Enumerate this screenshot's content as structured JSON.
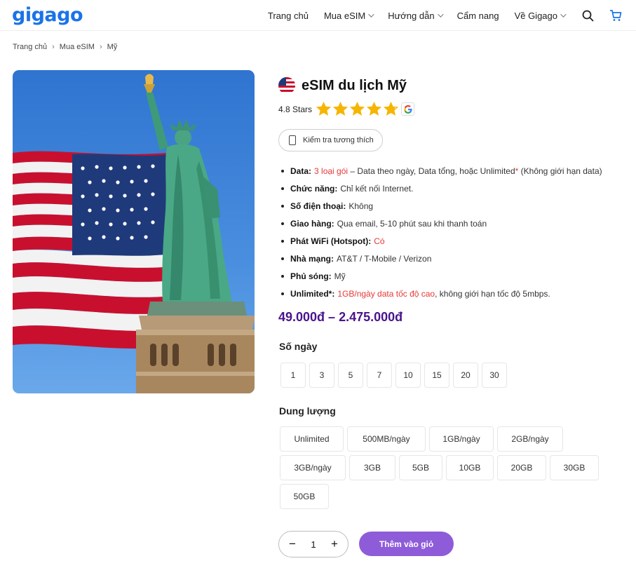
{
  "header": {
    "logo": "gigago",
    "nav": [
      {
        "label": "Trang chủ",
        "dropdown": false
      },
      {
        "label": "Mua eSIM",
        "dropdown": true
      },
      {
        "label": "Hướng dẫn",
        "dropdown": true
      },
      {
        "label": "Cẩm nang",
        "dropdown": false
      },
      {
        "label": "Về Gigago",
        "dropdown": true
      }
    ],
    "icons": [
      "search-icon",
      "cart-icon"
    ]
  },
  "breadcrumb": [
    "Trang chủ",
    "Mua eSIM",
    "Mỹ"
  ],
  "product": {
    "title": "eSIM du lịch Mỹ",
    "rating_text": "4.8 Stars",
    "rating_value": 4.8,
    "check_button": "Kiểm tra tương thích",
    "specs": [
      {
        "label": "Data:",
        "parts": [
          {
            "text": "3 loại gói",
            "red": true
          },
          {
            "text": " – Data theo ngày, Data tổng, hoặc Unlimited",
            "red": false
          },
          {
            "text": "*",
            "red": true
          },
          {
            "text": " (Không giới hạn data)",
            "red": false
          }
        ]
      },
      {
        "label": "Chức năng:",
        "parts": [
          {
            "text": "Chỉ kết nối Internet.",
            "red": false
          }
        ]
      },
      {
        "label": "Số điện thoại:",
        "parts": [
          {
            "text": "Không",
            "red": false
          }
        ]
      },
      {
        "label": "Giao hàng:",
        "parts": [
          {
            "text": "Qua email, 5-10 phút sau khi thanh toán",
            "red": false
          }
        ]
      },
      {
        "label": "Phát WiFi (Hotspot):",
        "parts": [
          {
            "text": "Có",
            "red": true
          }
        ]
      },
      {
        "label": "Nhà mạng:",
        "parts": [
          {
            "text": "AT&T / T-Mobile / Verizon",
            "red": false
          }
        ]
      },
      {
        "label": "Phủ sóng:",
        "parts": [
          {
            "text": "Mỹ",
            "red": false
          }
        ]
      },
      {
        "label": "Unlimited*:",
        "parts": [
          {
            "text": "1GB/ngày data tốc độ cao",
            "red": true
          },
          {
            "text": ", không giới hạn tốc độ 5mbps.",
            "red": false
          }
        ]
      }
    ],
    "price": "49.000đ – 2.475.000đ",
    "days_label": "Số ngày",
    "days": [
      "1",
      "3",
      "5",
      "7",
      "10",
      "15",
      "20",
      "30"
    ],
    "data_label": "Dung lượng",
    "data_rows": [
      [
        "Unlimited",
        "500MB/ngày",
        "1GB/ngày",
        "2GB/ngày"
      ],
      [
        "3GB/ngày",
        "3GB",
        "5GB",
        "10GB",
        "20GB",
        "30GB"
      ],
      [
        "50GB"
      ]
    ],
    "quantity": "1",
    "qty_minus": "−",
    "qty_plus": "+",
    "add_to_cart": "Thêm vào giỏ"
  },
  "colors": {
    "brand_blue": "#1a73e8",
    "price_purple": "#4a148c",
    "button_purple": "#8e5cd9",
    "star_yellow": "#f6b500",
    "accent_red": "#e53935"
  }
}
